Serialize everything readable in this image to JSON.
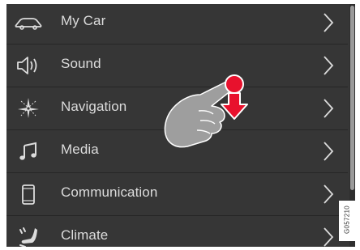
{
  "menu": {
    "items": [
      {
        "label": "My Car",
        "icon": "car-icon"
      },
      {
        "label": "Sound",
        "icon": "speaker-icon"
      },
      {
        "label": "Navigation",
        "icon": "navigation-icon"
      },
      {
        "label": "Media",
        "icon": "music-note-icon"
      },
      {
        "label": "Communication",
        "icon": "phone-icon"
      },
      {
        "label": "Climate",
        "icon": "climate-seat-icon"
      }
    ]
  },
  "gesture": {
    "type": "tap-and-swipe-down",
    "icon": "hand-swipe-down-icon"
  },
  "figure_code": "G057210",
  "colors": {
    "background": "#363636",
    "text": "#dcdcdc",
    "accent": "#e8112d",
    "hand": "#9e9e9e"
  }
}
